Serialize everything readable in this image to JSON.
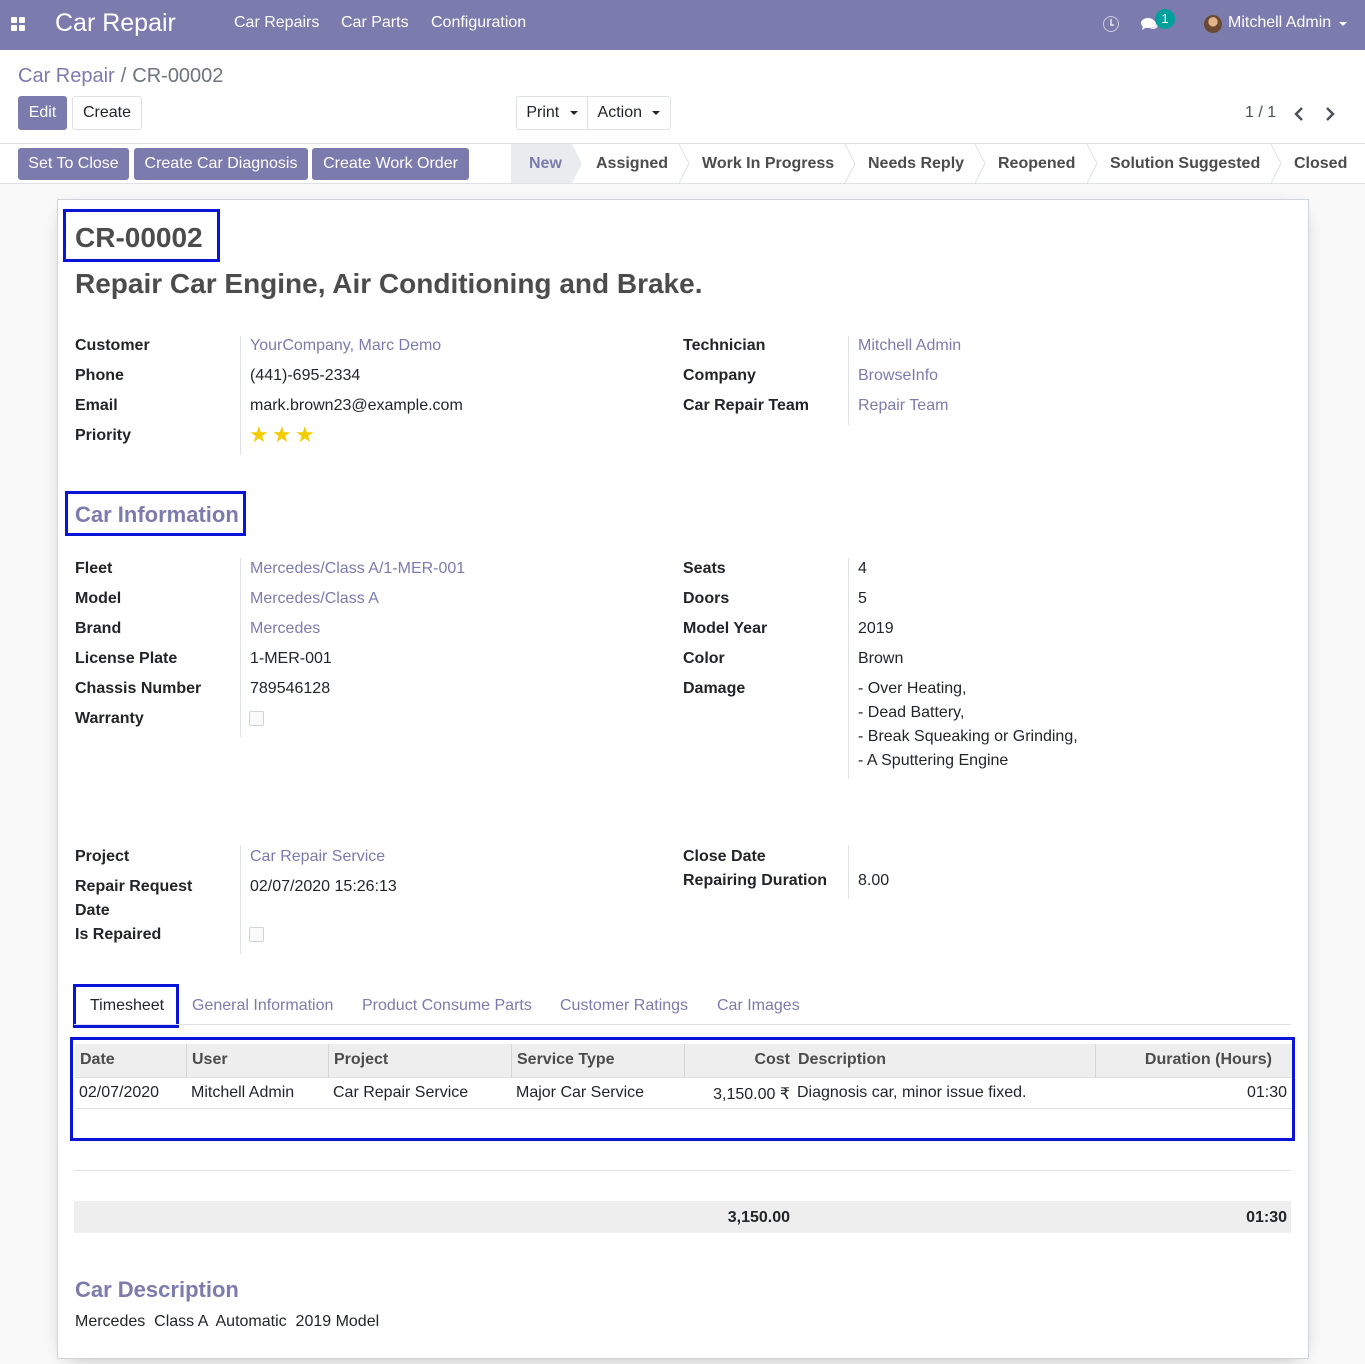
{
  "navbar": {
    "app_title": "Car Repair",
    "menu": [
      "Car Repairs",
      "Car Parts",
      "Configuration"
    ],
    "chat_badge": "1",
    "user_name": "Mitchell Admin",
    "bg_color": "#7c7bad"
  },
  "breadcrumb": {
    "parent": "Car Repair",
    "separator": "/",
    "current": "CR-00002"
  },
  "buttons": {
    "edit": "Edit",
    "create": "Create",
    "print": "Print",
    "action": "Action"
  },
  "pager": {
    "text": "1 / 1"
  },
  "statusbar": {
    "buttons": [
      "Set To Close",
      "Create Car Diagnosis",
      "Create Work Order"
    ],
    "stages": [
      "New",
      "Assigned",
      "Work In Progress",
      "Needs Reply",
      "Reopened",
      "Solution Suggested",
      "Closed"
    ],
    "active_stage": "New"
  },
  "record": {
    "reference": "CR-00002",
    "title": "Repair Car Engine, Air Conditioning and Brake.",
    "left": [
      {
        "label": "Customer",
        "value": "YourCompany, Marc Demo"
      },
      {
        "label": "Phone",
        "value": "(441)-695-2334"
      },
      {
        "label": "Email",
        "value": "mark.brown23@example.com"
      },
      {
        "label": "Priority",
        "value": ""
      }
    ],
    "priority_stars": 3,
    "right": [
      {
        "label": "Technician",
        "value": "Mitchell Admin"
      },
      {
        "label": "Company",
        "value": "BrowseInfo"
      },
      {
        "label": "Car Repair Team",
        "value": "Repair Team"
      }
    ]
  },
  "car_info": {
    "section_title": "Car Information",
    "left": [
      {
        "label": "Fleet",
        "value": "Mercedes/Class A/1-MER-001"
      },
      {
        "label": "Model",
        "value": "Mercedes/Class A"
      },
      {
        "label": "Brand",
        "value": "Mercedes"
      },
      {
        "label": "License Plate",
        "value": "1-MER-001"
      },
      {
        "label": "Chassis Number",
        "value": "789546128"
      },
      {
        "label": "Warranty",
        "value": ""
      }
    ],
    "right": [
      {
        "label": "Seats",
        "value": "4"
      },
      {
        "label": "Doors",
        "value": "5"
      },
      {
        "label": "Model Year",
        "value": "2019"
      },
      {
        "label": "Color",
        "value": "Brown"
      },
      {
        "label": "Damage",
        "value": ""
      }
    ],
    "damage_lines": [
      "- Over Heating,",
      "- Dead Battery,",
      "- Break Squeaking or Grinding,",
      "- A Sputtering Engine"
    ]
  },
  "project_info": {
    "project_label": "Project",
    "project_value": "Car Repair Service",
    "request_label_1": "Repair Request",
    "request_label_2": "Date",
    "request_value": "02/07/2020 15:26:13",
    "repaired_label": "Is Repaired",
    "close_date_label": "Close Date",
    "close_date_value": "",
    "duration_label": "Repairing Duration",
    "duration_value": "8.00"
  },
  "tabs": [
    "Timesheet",
    "General Information",
    "Product Consume Parts",
    "Customer Ratings",
    "Car Images"
  ],
  "timesheet": {
    "columns": [
      "Date",
      "User",
      "Project",
      "Service Type",
      "Cost",
      "Description",
      "Duration (Hours)"
    ],
    "rows": [
      [
        "02/07/2020",
        "Mitchell Admin",
        "Car Repair Service",
        "Major Car Service",
        "3,150.00 ₹",
        "Diagnosis car, minor issue fixed.",
        "01:30"
      ]
    ],
    "total_cost": "3,150.00",
    "total_duration": "01:30"
  },
  "car_description": {
    "title": "Car Description",
    "text": "Mercedes  Class A  Automatic  2019 Model"
  }
}
